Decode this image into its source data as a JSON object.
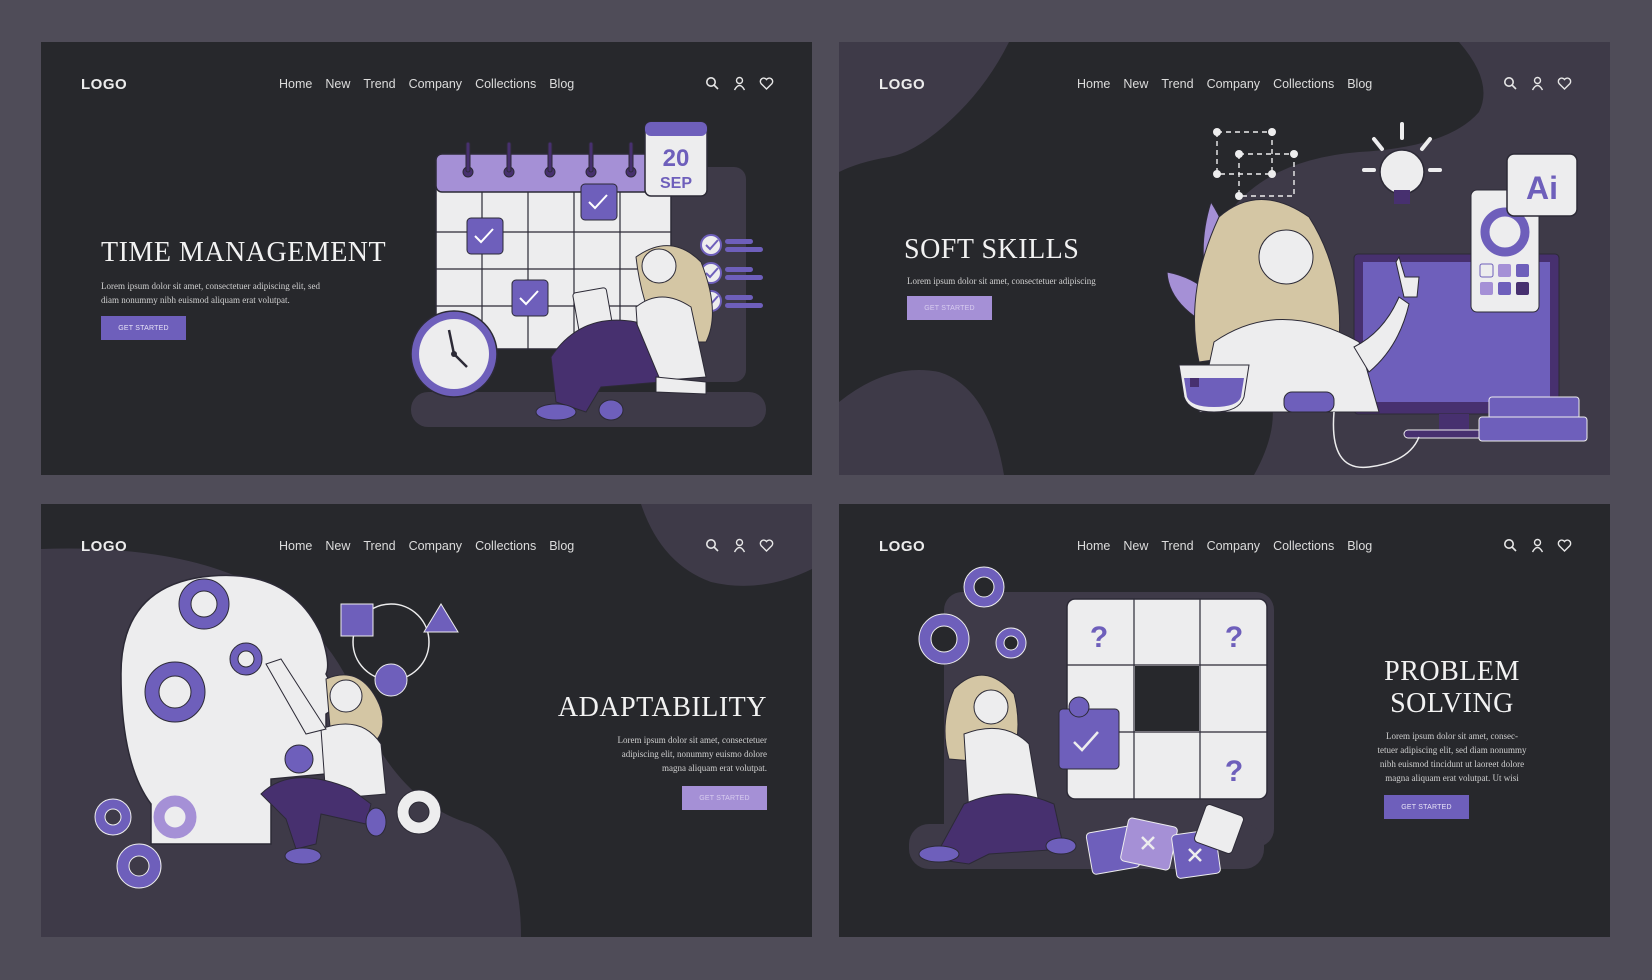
{
  "colors": {
    "page_bg": "#4f4c58",
    "card_bg": "#27282c",
    "blob": "#3e3a48",
    "accent": "#6e5fbb",
    "accent_light": "#a590d6",
    "deep_purple": "#47306f",
    "hair": "#d4c6a4",
    "off_white": "#ededee"
  },
  "nav": {
    "logo": "LOGO",
    "items": [
      "Home",
      "New",
      "Trend",
      "Company",
      "Collections",
      "Blog"
    ],
    "icons": [
      "search-icon",
      "user-icon",
      "heart-icon"
    ]
  },
  "cards": [
    {
      "title": "TIME MANAGEMENT",
      "text_lines": [
        "Lorem ipsum dolor sit amet, consectetuer adipiscing elit, sed",
        "diam nonummy nibh euismod aliquam erat volutpat."
      ],
      "button": "GET STARTED",
      "calendar": {
        "day": "20",
        "month": "SEP"
      }
    },
    {
      "title": "SOFT SKILLS",
      "text_lines": [
        "Lorem ipsum dolor sit amet, consectetuer adipiscing"
      ],
      "button": "GET STARTED",
      "app_badge": "Ai"
    },
    {
      "title": "ADAPTABILITY",
      "text_lines": [
        "Lorem ipsum dolor sit amet, consectetuer",
        "adipiscing elit, nonummy euismo dolore",
        "magna aliquam erat volutpat."
      ],
      "button": "GET STARTED"
    },
    {
      "title_lines": [
        "PROBLEM",
        "SOLVING"
      ],
      "text_lines": [
        "Lorem ipsum dolor sit amet, consec-",
        "tetuer adipiscing elit, sed diam nonummy",
        "nibh euismod tincidunt ut laoreet dolore",
        "magna aliquam erat volutpat. Ut wisi"
      ],
      "button": "GET STARTED"
    }
  ]
}
